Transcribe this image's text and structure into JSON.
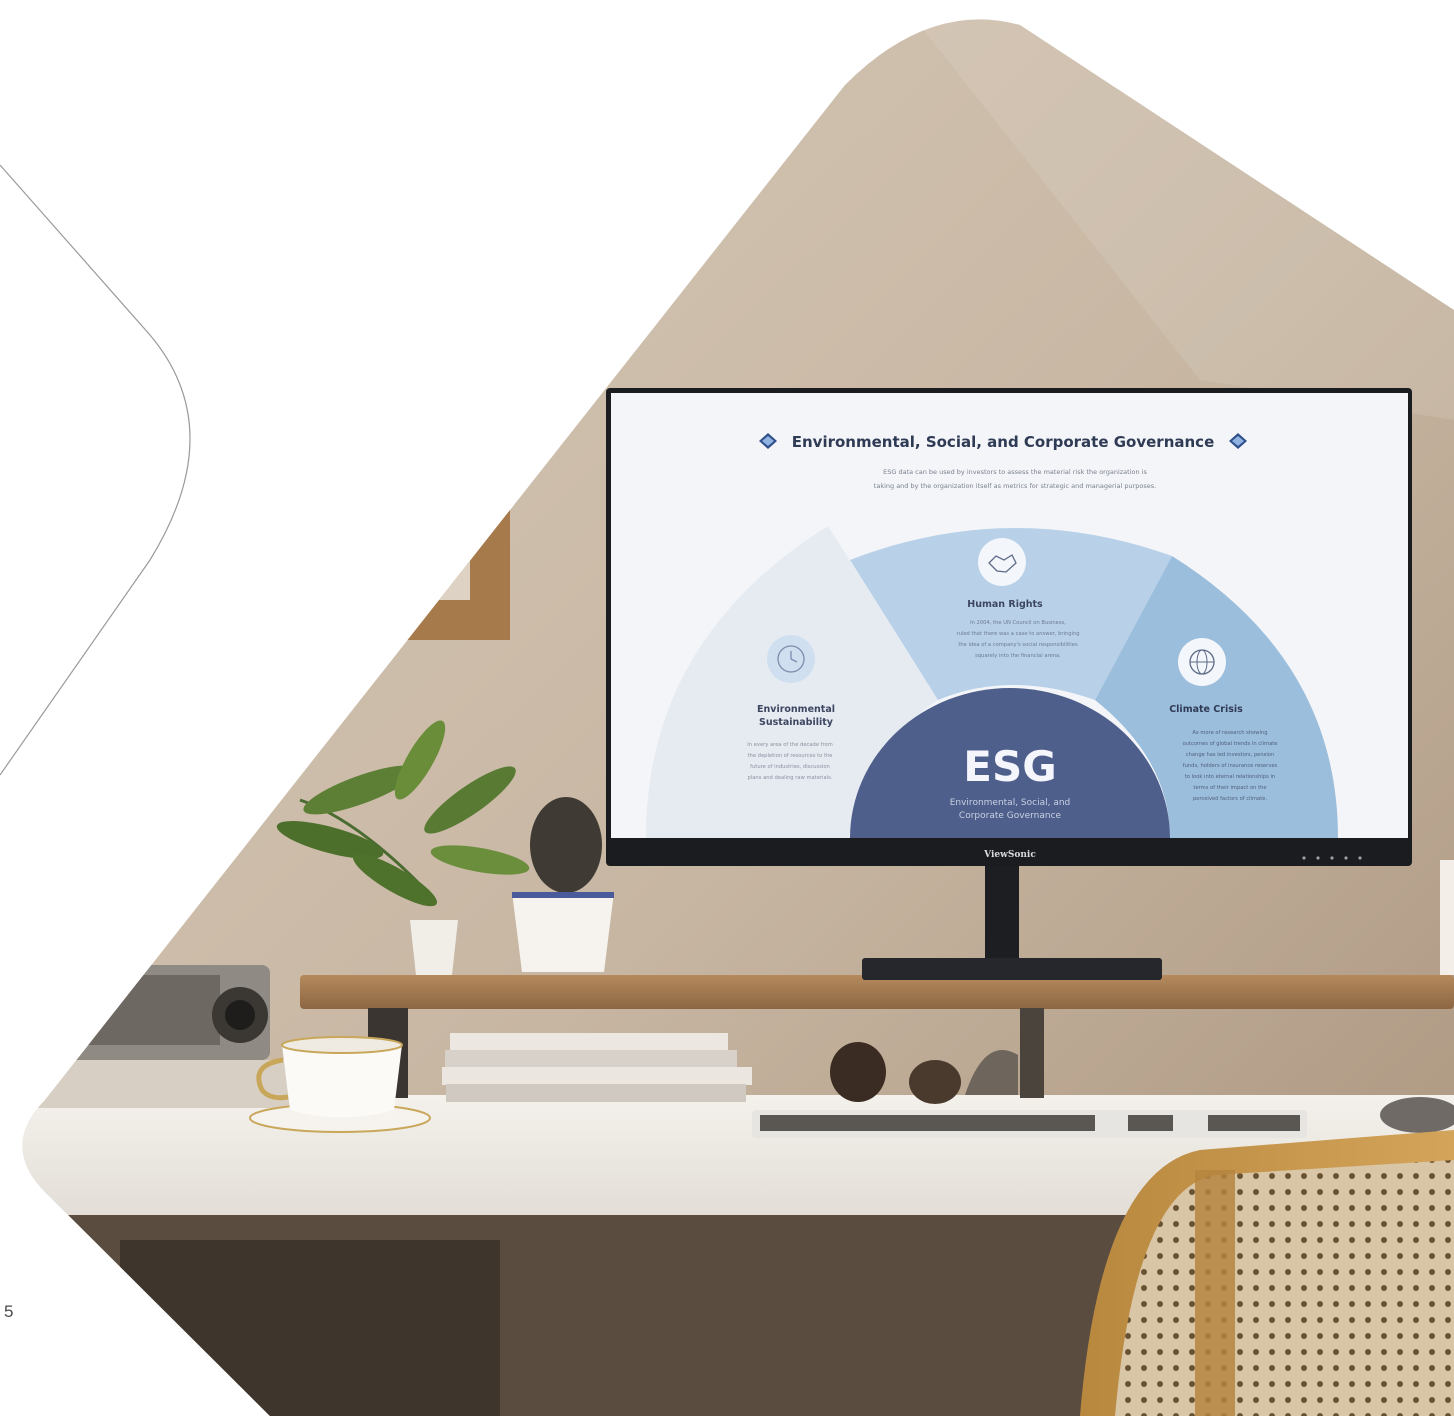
{
  "page": {
    "page_number": "5"
  },
  "monitor": {
    "brand": "ViewSonic",
    "screen": {
      "title": "Environmental, Social, and Corporate Governance",
      "subtitle_line1": "ESG data can be used by investors to assess the material risk the organization is",
      "subtitle_line2": "taking and by the organization itself as metrics for strategic and managerial purposes.",
      "center_label": "ESG",
      "center_sub_line1": "Environmental, Social, and",
      "center_sub_line2": "Corporate Governance",
      "segments": [
        {
          "title_line1": "Environmental",
          "title_line2": "Sustainability",
          "icon": "clock-icon",
          "body": [
            "In every area of the decade from",
            "the depletion of resources to the",
            "future of industries, discussion",
            "plans and dealing raw materials."
          ]
        },
        {
          "title": "Human Rights",
          "icon": "handshake-icon",
          "body": [
            "In 2004, the UN Council on Business,",
            "ruled that there was a case to answer, bringing",
            "the idea of a company's social responsibilities",
            "squarely into the financial arena."
          ]
        },
        {
          "title": "Climate Crisis",
          "icon": "globe-icon",
          "body": [
            "As more of research showing",
            "outcomes of global trends in climate",
            "change has led investors, pension",
            "funds, holders of insurance reserves",
            "to look into eternal relationships in",
            "terms of their impact on the",
            "perceived factors of climate."
          ]
        }
      ]
    }
  },
  "colors": {
    "wall": "#c9b9a5",
    "desk": "#efebe6",
    "shelf": "#a77d52",
    "screen_bg": "#f3f5f8",
    "esg_dark": "#4f5f8c",
    "segment_light": "#e6ebf1",
    "segment_mid": "#b8d1e8",
    "segment_right": "#9cbedd"
  }
}
